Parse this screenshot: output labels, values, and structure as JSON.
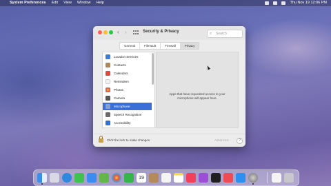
{
  "menubar": {
    "apple": "",
    "app_name": "System Preferences",
    "menus": [
      "Edit",
      "View",
      "Window",
      "Help"
    ],
    "datetime": "Thu Nov 19  12:06 PM"
  },
  "window": {
    "title": "Security & Privacy",
    "search_placeholder": "Search",
    "tabs": [
      "General",
      "FileVault",
      "Firewall",
      "Privacy"
    ],
    "active_tab": "Privacy",
    "sidebar_items": [
      {
        "label": "Location Services",
        "icon": "location-icon",
        "color": "#3a7bdc"
      },
      {
        "label": "Contacts",
        "icon": "contacts-icon",
        "color": "#b08a56"
      },
      {
        "label": "Calendars",
        "icon": "calendar-icon",
        "color": "#e14b3b"
      },
      {
        "label": "Reminders",
        "icon": "reminders-icon",
        "color": "#f2f2f2"
      },
      {
        "label": "Photos",
        "icon": "photos-icon",
        "color": "#f0a33a"
      },
      {
        "label": "Camera",
        "icon": "camera-icon",
        "color": "#555555"
      },
      {
        "label": "Microphone",
        "icon": "microphone-icon",
        "color": "#8aa0c8"
      },
      {
        "label": "Speech Recognition",
        "icon": "speech-recognition-icon",
        "color": "#6b6b6b"
      },
      {
        "label": "Accessibility",
        "icon": "accessibility-icon",
        "color": "#2f6fd8"
      }
    ],
    "selected_item": "Microphone",
    "content_message": "Apps that have requested access to your microphone will appear here.",
    "lock_text": "Click the lock to make changes.",
    "advanced_label": "Advanced...",
    "help_label": "?"
  },
  "dock": {
    "apps": [
      {
        "name": "finder-icon",
        "color": "#3b8fe8"
      },
      {
        "name": "launchpad-icon",
        "color": "#d9d9e6"
      },
      {
        "name": "safari-icon",
        "color": "#2f88e0"
      },
      {
        "name": "messages-icon",
        "color": "#3fc24f"
      },
      {
        "name": "mail-icon",
        "color": "#3a8cf0"
      },
      {
        "name": "maps-icon",
        "color": "#62b64a"
      },
      {
        "name": "photos-icon",
        "color": "#f2c14e"
      },
      {
        "name": "facetime-icon",
        "color": "#36b54a"
      },
      {
        "name": "calendar-icon",
        "color": "#ffffff"
      },
      {
        "name": "contacts-icon",
        "color": "#b58a5a"
      },
      {
        "name": "reminders-icon",
        "color": "#f4f4f4"
      },
      {
        "name": "notes-icon",
        "color": "#f7d74a"
      },
      {
        "name": "music-icon",
        "color": "#f2405a"
      },
      {
        "name": "podcasts-icon",
        "color": "#9c4fd6"
      },
      {
        "name": "apple-tv-icon",
        "color": "#1f1f1f"
      },
      {
        "name": "news-icon",
        "color": "#f04b55"
      },
      {
        "name": "app-store-icon",
        "color": "#2d8ff0"
      },
      {
        "name": "system-preferences-icon",
        "color": "#8a8a8a"
      }
    ],
    "trailing": [
      {
        "name": "document-icon",
        "color": "#f4f4f4"
      },
      {
        "name": "trash-icon",
        "color": "#c8c8cc"
      }
    ],
    "calendar_day": "19"
  }
}
